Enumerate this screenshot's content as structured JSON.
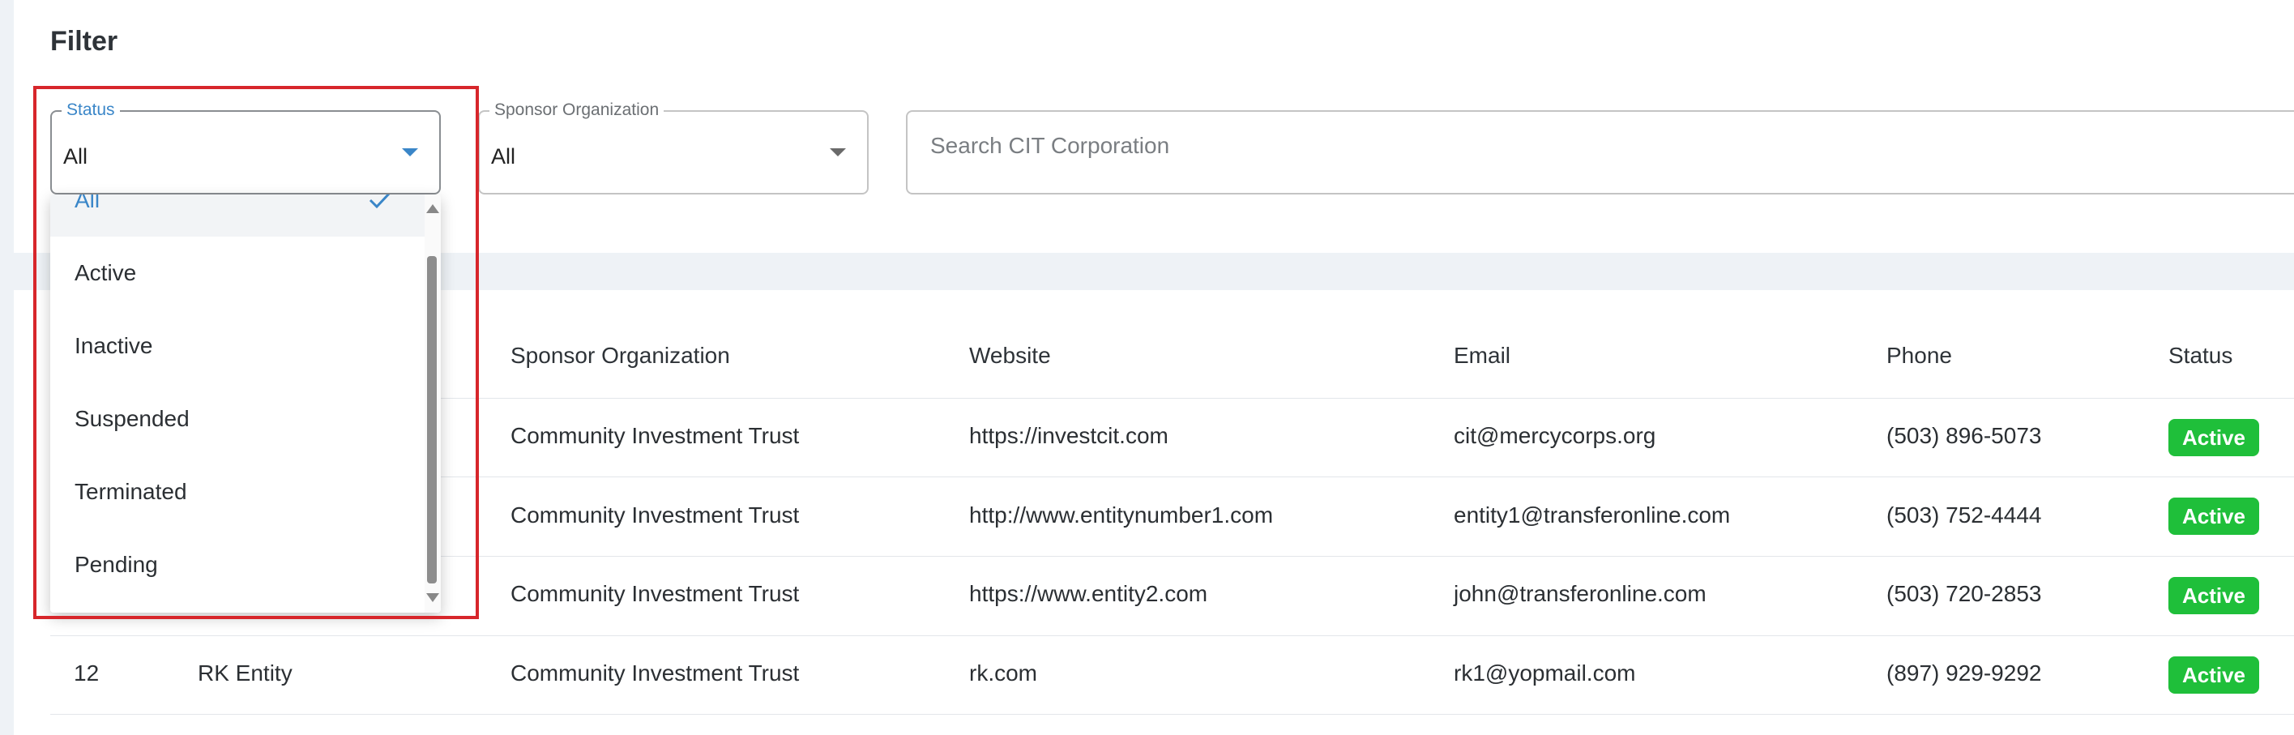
{
  "filter": {
    "title": "Filter",
    "status": {
      "legend": "Status",
      "value": "All"
    },
    "sponsor": {
      "legend": "Sponsor Organization",
      "value": "All"
    },
    "search": {
      "placeholder": "Search CIT Corporation"
    }
  },
  "status_menu": {
    "options": [
      "All",
      "Active",
      "Inactive",
      "Suspended",
      "Terminated",
      "Pending"
    ],
    "selected": "All"
  },
  "table": {
    "headers": {
      "sponsor": "Sponsor Organization",
      "website": "Website",
      "email": "Email",
      "phone": "Phone",
      "status": "Status"
    },
    "rows": [
      {
        "id": "",
        "name": "",
        "sponsor": "Community Investment Trust",
        "website": "https://investcit.com",
        "email": "cit@mercycorps.org",
        "phone": "(503) 896-5073",
        "status": "Active"
      },
      {
        "id": "",
        "name": "",
        "sponsor": "Community Investment Trust",
        "website": "http://www.entitynumber1.com",
        "email": "entity1@transferonline.com",
        "phone": "(503) 752-4444",
        "status": "Active"
      },
      {
        "id": "",
        "name": "",
        "sponsor": "Community Investment Trust",
        "website": "https://www.entity2.com",
        "email": "john@transferonline.com",
        "phone": "(503) 720-2853",
        "status": "Active"
      },
      {
        "id": "12",
        "name": "RK Entity",
        "sponsor": "Community Investment Trust",
        "website": "rk.com",
        "email": "rk1@yopmail.com",
        "phone": "(897) 929-9292",
        "status": "Active"
      }
    ]
  },
  "colors": {
    "accent": "#3a86c8",
    "active_badge": "#1fbf3a",
    "highlight_box": "#d7262b"
  }
}
